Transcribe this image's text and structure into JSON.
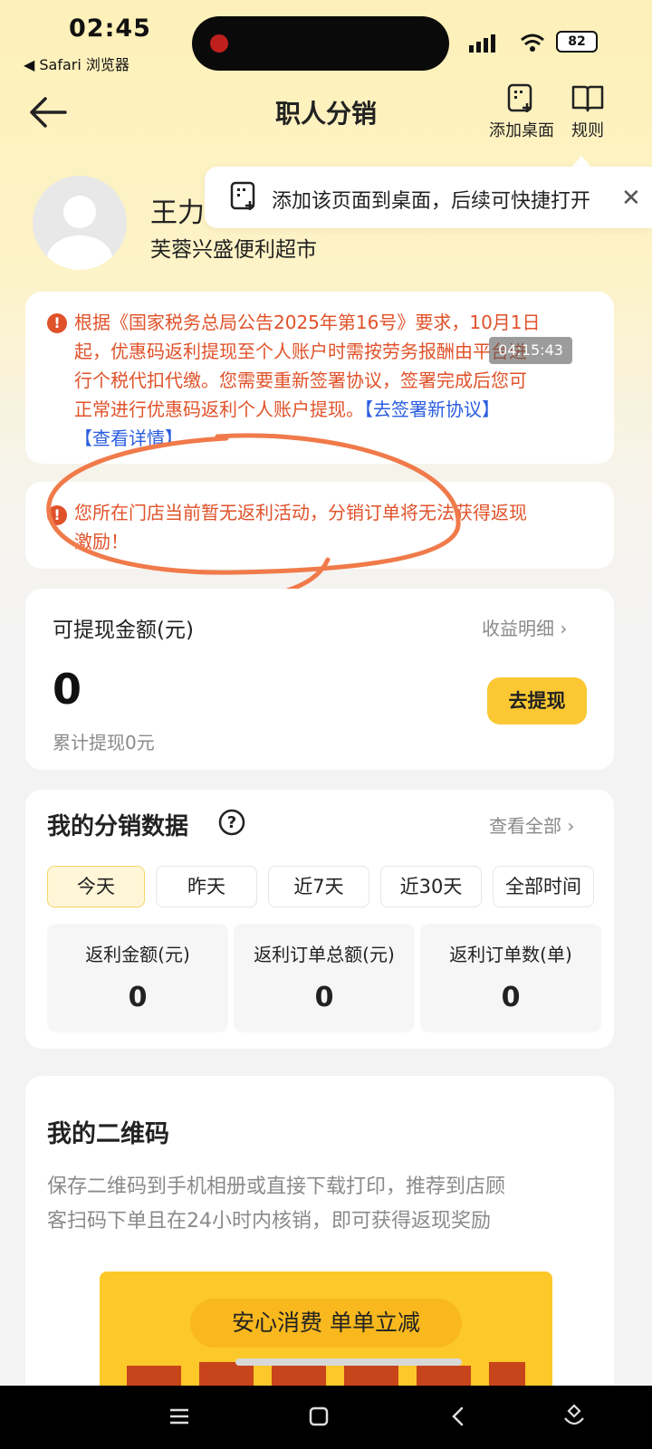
{
  "status_bar": {
    "time": "02:45",
    "back_app": "◀ Safari 浏览器",
    "battery": "82"
  },
  "header": {
    "title": "职人分销",
    "add_desktop_label": "添加桌面",
    "rules_label": "规则"
  },
  "tooltip": {
    "text": "添加该页面到桌面，后续可快捷打开",
    "close": "✕"
  },
  "profile": {
    "name": "王力",
    "store": "芙蓉兴盛便利超市"
  },
  "notice_tax": {
    "text_1": "根据《国家税务总局公告2025年第16号》要求，10月1日",
    "text_2": "起，优惠码返利提现至个人账户时需按劳务报酬由平台进",
    "text_3": "行个税代扣代缴。您需要重新签署协议，签署完成后您可",
    "text_4": "正常进行优惠码返利个人账户提现。",
    "link_sign": "【去签署新协议】",
    "link_detail": "【查看详情】"
  },
  "overlay_timestamp": "04:15:43",
  "notice_store": {
    "text_1": "您所在门店当前暂无返利活动，分销订单将无法获得返现",
    "text_2": "激励！"
  },
  "withdraw": {
    "title": "可提现金额(元)",
    "detail_link": "收益明细",
    "amount": "0",
    "button": "去提现",
    "total": "累计提现0元"
  },
  "distribution": {
    "title": "我的分销数据",
    "view_all": "查看全部",
    "tabs": [
      "今天",
      "昨天",
      "近7天",
      "近30天",
      "全部时间"
    ],
    "active_tab": "今天",
    "stats": [
      {
        "label": "返利金额(元)",
        "value": "0"
      },
      {
        "label": "返利订单总额(元)",
        "value": "0"
      },
      {
        "label": "返利订单数(单)",
        "value": "0"
      }
    ]
  },
  "qrcode": {
    "title": "我的二维码",
    "desc_1": "保存二维码到手机相册或直接下载打印，推荐到店顾",
    "desc_2": "客扫码下单且在24小时内核销，即可获得返现奖励",
    "poster_pill": "安心消费 单单立减"
  },
  "colors": {
    "accent_yellow": "#fbc833",
    "warning_orange": "#e0522a",
    "link_blue": "#2b5de0",
    "annotation_orange": "#f07a4a"
  }
}
